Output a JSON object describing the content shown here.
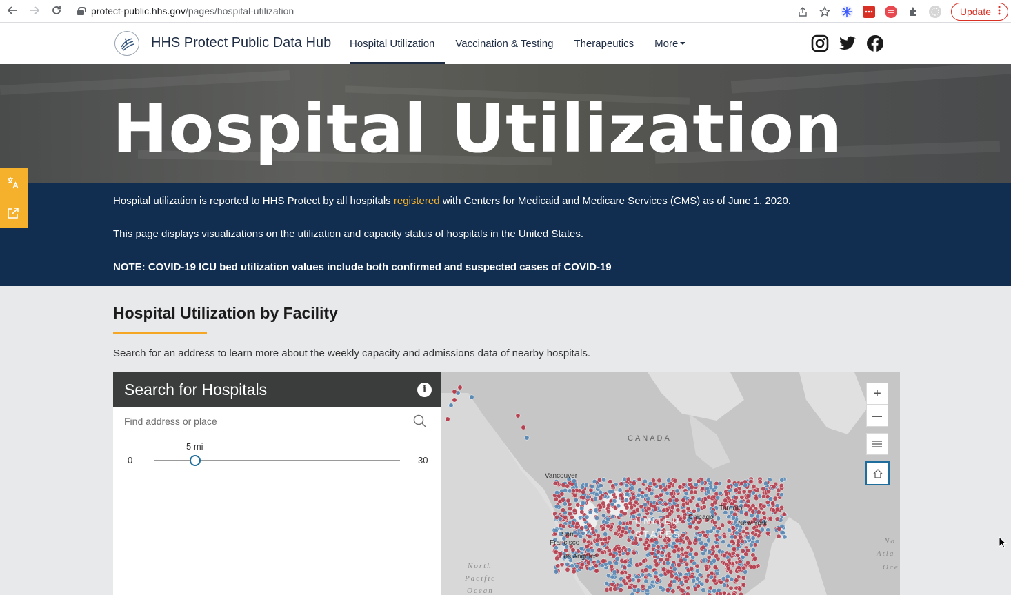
{
  "browser": {
    "url_host": "protect-public.hhs.gov",
    "url_path": "/pages/hospital-utilization",
    "update_label": "Update"
  },
  "header": {
    "site_title": "HHS Protect Public Data Hub",
    "nav": [
      {
        "label": "Hospital Utilization"
      },
      {
        "label": "Vaccination & Testing"
      },
      {
        "label": "Therapeutics"
      },
      {
        "label": "More"
      }
    ]
  },
  "hero": {
    "title": "Hospital Utilization"
  },
  "info": {
    "line1_before": "Hospital utilization is reported to HHS Protect by all hospitals ",
    "line1_link": "registered",
    "line1_after": " with Centers for Medicaid and Medicare Services (CMS) as of June 1, 2020.",
    "line2": "This page displays visualizations on the utilization and capacity status of hospitals in the United States.",
    "note": "NOTE: COVID-19 ICU bed utilization values include both confirmed and suspected cases of COVID-19"
  },
  "section": {
    "title": "Hospital Utilization by Facility",
    "description": "Search for an address to learn more about the weekly capacity and admissions data of nearby hospitals."
  },
  "search_panel": {
    "title": "Search for Hospitals",
    "info_label": "i",
    "placeholder": "Find address or place",
    "slider_value_label": "5 mi",
    "slider_min": "0",
    "slider_max": "30",
    "slider_value": 5
  },
  "map": {
    "labels": {
      "canada": "CANADA",
      "vancouver": "Vancouver",
      "united": "UNITED",
      "states": "STATES",
      "chicago": "Chicago",
      "toronto": "Toronto",
      "new_york": "New York",
      "san": "San",
      "francisco": "Francisco",
      "los_angeles": "Los Angeles",
      "north": "North",
      "pacific": "Pacific",
      "ocean": "Ocean",
      "no": "No",
      "atla": "Atla",
      "oce": "Oce"
    },
    "controls": {
      "zoom_in": "+",
      "zoom_out": "—"
    },
    "colors": {
      "red_dot": "#b5404f",
      "blue_dot": "#5b8ab5",
      "land": "#c6c6c6",
      "water": "#dcdcdc"
    }
  }
}
